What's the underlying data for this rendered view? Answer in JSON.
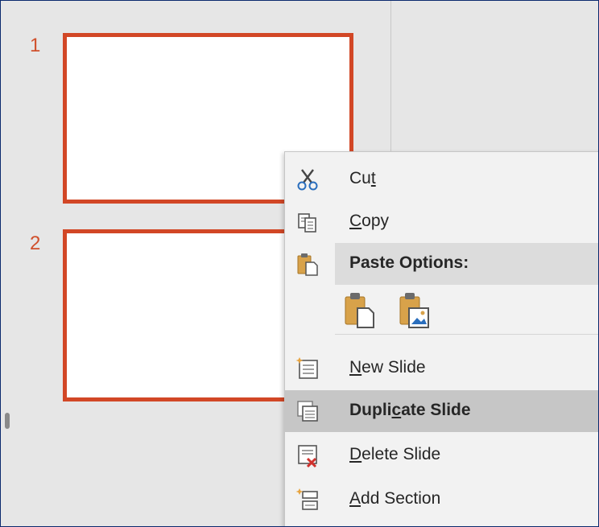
{
  "slides": [
    {
      "number": "1"
    },
    {
      "number": "2"
    }
  ],
  "context_menu": {
    "items": [
      {
        "id": "cut",
        "pre": "Cu",
        "accel": "t",
        "post": "",
        "icon": "scissors-icon"
      },
      {
        "id": "copy",
        "pre": "",
        "accel": "C",
        "post": "opy",
        "icon": "copy-icon"
      },
      {
        "id": "paste_options",
        "label": "Paste Options:",
        "icon": "paste-icon"
      },
      {
        "id": "new_slide",
        "pre": "",
        "accel": "N",
        "post": "ew Slide",
        "icon": "new-slide-icon"
      },
      {
        "id": "duplicate_slide",
        "pre": "Dupli",
        "accel": "c",
        "post": "ate Slide",
        "icon": "duplicate-slide-icon",
        "highlighted": true
      },
      {
        "id": "delete_slide",
        "pre": "",
        "accel": "D",
        "post": "elete Slide",
        "icon": "delete-slide-icon"
      },
      {
        "id": "add_section",
        "pre": "",
        "accel": "A",
        "post": "dd Section",
        "icon": "add-section-icon"
      }
    ],
    "paste_buttons": [
      {
        "icon": "paste-use-destination-theme-icon"
      },
      {
        "icon": "paste-picture-icon"
      }
    ]
  },
  "colors": {
    "accent": "#d24726",
    "menu_bg": "#f2f2f2",
    "highlight": "#c6c6c6",
    "pane_bg": "#e6e6e6"
  }
}
